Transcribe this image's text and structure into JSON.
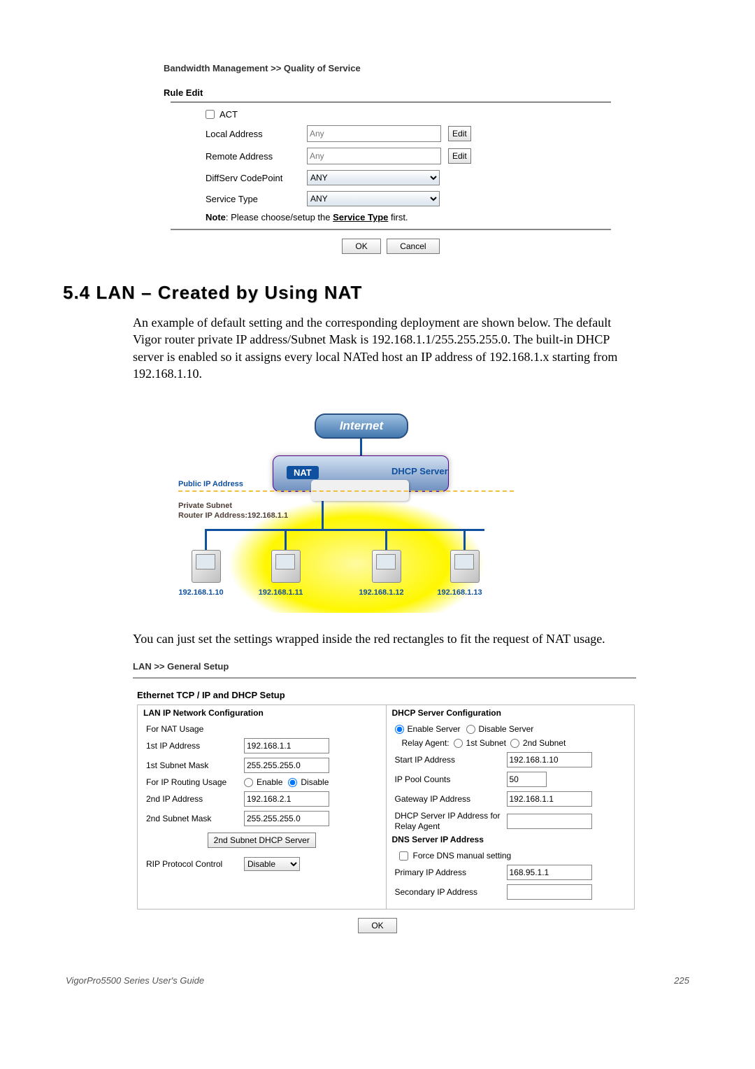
{
  "breadcrumb1": "Bandwidth Management >> Quality of Service",
  "ruleEdit": {
    "title": "Rule Edit",
    "act": "ACT",
    "localAddressLabel": "Local Address",
    "localAddressValue": "Any",
    "remoteAddressLabel": "Remote Address",
    "remoteAddressValue": "Any",
    "diffservLabel": "DiffServ CodePoint",
    "diffservValue": "ANY",
    "serviceTypeLabel": "Service Type",
    "serviceTypeValue": "ANY",
    "editBtn": "Edit",
    "notePrefix": "Note",
    "noteText": ": Please choose/setup the ",
    "noteLink": "Service Type",
    "noteSuffix": " first.",
    "ok": "OK",
    "cancel": "Cancel"
  },
  "section": {
    "heading": "5.4 LAN – Created by Using NAT",
    "para1": "An example of default setting and the corresponding deployment are shown below. The default Vigor router private IP address/Subnet Mask is 192.168.1.1/255.255.255.0. The built-in DHCP server is enabled so it assigns every local NATed host an IP address of 192.168.1.x starting from 192.168.1.10.",
    "para2": "You can just set the settings wrapped inside the red rectangles to fit the request of NAT usage."
  },
  "diagram": {
    "internet": "Internet",
    "nat": "NAT",
    "dhcp": "DHCP Server",
    "publicIp": "Public IP Address",
    "privateLine1": "Private Subnet",
    "privateLine2": "Router IP Address:192.168.1.1",
    "pc1": "192.168.1.10",
    "pc2": "192.168.1.11",
    "pc3": "192.168.1.12",
    "pc4": "192.168.1.13"
  },
  "breadcrumb2": "LAN >> General Setup",
  "panel2Title": "Ethernet TCP / IP and DHCP Setup",
  "lan": {
    "header": "LAN IP Network Configuration",
    "forNat": "For NAT Usage",
    "ip1Label": "1st IP Address",
    "ip1Value": "192.168.1.1",
    "mask1Label": "1st Subnet Mask",
    "mask1Value": "255.255.255.0",
    "routingLabel": "For IP Routing Usage",
    "enable": "Enable",
    "disable": "Disable",
    "ip2Label": "2nd IP Address",
    "ip2Value": "192.168.2.1",
    "mask2Label": "2nd Subnet Mask",
    "mask2Value": "255.255.255.0",
    "dhcp2Btn": "2nd Subnet DHCP Server",
    "ripLabel": "RIP Protocol Control",
    "ripValue": "Disable"
  },
  "dhcp": {
    "header": "DHCP Server Configuration",
    "enableServer": "Enable Server",
    "disableServer": "Disable Server",
    "relayLabel": "Relay Agent:",
    "relay1": "1st Subnet",
    "relay2": "2nd Subnet",
    "startIpLabel": "Start IP Address",
    "startIpValue": "192.168.1.10",
    "poolLabel": "IP Pool Counts",
    "poolValue": "50",
    "gatewayLabel": "Gateway IP Address",
    "gatewayValue": "192.168.1.1",
    "dhcpRelayIpLabel": "DHCP Server IP Address for Relay Agent",
    "dnsHeader": "DNS Server IP Address",
    "forceDns": "Force DNS manual setting",
    "primaryLabel": "Primary IP Address",
    "primaryValue": "168.95.1.1",
    "secondaryLabel": "Secondary IP Address",
    "ok": "OK"
  },
  "footer": {
    "left": "VigorPro5500 Series User's Guide",
    "right": "225"
  }
}
